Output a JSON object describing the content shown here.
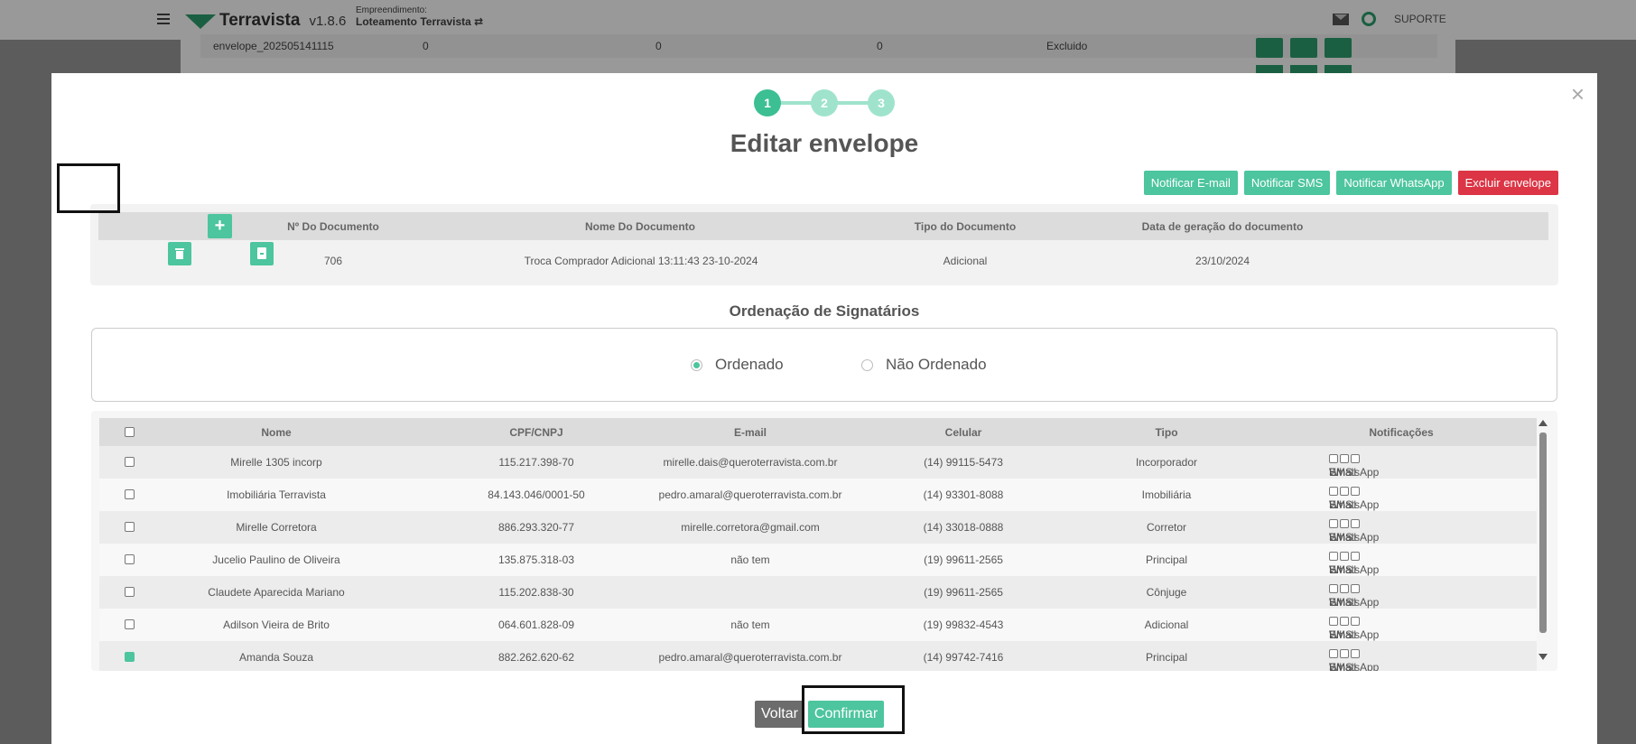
{
  "nav": {
    "brand": "Terravista",
    "version": "v1.8.6",
    "emp_label": "Empreendimento:",
    "emp_value": "Loteamento Terravista ⇄",
    "support": "SUPORTE"
  },
  "bg_row": {
    "name": "envelope_202505141115",
    "v1": "0",
    "v2": "0",
    "v3": "0",
    "status": "Excluido"
  },
  "modal": {
    "close": "×",
    "steps": [
      "1",
      "2",
      "3"
    ],
    "title": "Editar envelope",
    "actions": {
      "email": "Notificar E-mail",
      "sms": "Notificar SMS",
      "whatsapp": "Notificar WhatsApp",
      "delete": "Excluir envelope"
    },
    "doc_table": {
      "plus": "+",
      "headers": {
        "num": "Nº Do Documento",
        "name": "Nome Do Documento",
        "type": "Tipo do Documento",
        "date": "Data de geração do documento"
      },
      "row": {
        "num": "706",
        "name": "Troca Comprador Adicional 13:11:43 23-10-2024",
        "type": "Adicional",
        "date": "23/10/2024"
      }
    },
    "ordering": {
      "title": "Ordenação de Signatários",
      "ordered": "Ordenado",
      "unordered": "Não Ordenado"
    },
    "signers": {
      "headers": {
        "name": "Nome",
        "doc": "CPF/CNPJ",
        "email": "E-mail",
        "phone": "Celular",
        "type": "Tipo",
        "notif": "Notificações"
      },
      "notif_labels": {
        "email": "Email",
        "sms": "SMS",
        "whatsapp": "WhatsApp"
      },
      "rows": [
        {
          "name": "Mirelle 1305 incorp",
          "doc": "115.217.398-70",
          "email": "mirelle.dais@queroterravista.com.br",
          "phone": "(14) 99115-5473",
          "type": "Incorporador"
        },
        {
          "name": "Imobiliária Terravista",
          "doc": "84.143.046/0001-50",
          "email": "pedro.amaral@queroterravista.com.br",
          "phone": "(14) 93301-8088",
          "type": "Imobiliária"
        },
        {
          "name": "Mirelle Corretora",
          "doc": "886.293.320-77",
          "email": "mirelle.corretora@gmail.com",
          "phone": "(14) 33018-0888",
          "type": "Corretor"
        },
        {
          "name": "Jucelio Paulino de Oliveira",
          "doc": "135.875.318-03",
          "email": "não tem",
          "phone": "(19) 99611-2565",
          "type": "Principal"
        },
        {
          "name": "Claudete Aparecida Mariano",
          "doc": "115.202.838-30",
          "email": "",
          "phone": "(19) 99611-2565",
          "type": "Cônjuge"
        },
        {
          "name": "Adilson Vieira de Brito",
          "doc": "064.601.828-09",
          "email": "não tem",
          "phone": "(19) 99832-4543",
          "type": "Adicional"
        },
        {
          "name": "Amanda Souza",
          "doc": "882.262.620-62",
          "email": "pedro.amaral@queroterravista.com.br",
          "phone": "(14) 99742-7416",
          "type": "Principal"
        }
      ]
    },
    "footer": {
      "back": "Voltar",
      "confirm": "Confirmar"
    }
  }
}
